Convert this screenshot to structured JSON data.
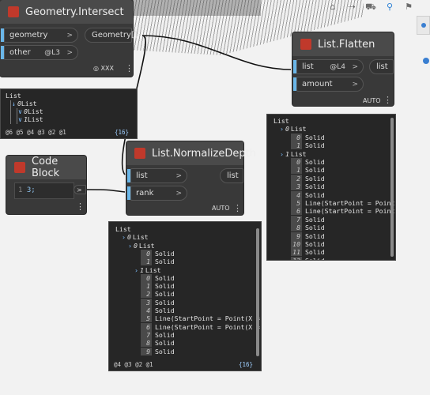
{
  "toolbar": {
    "icons": [
      "home-icon",
      "road-icon",
      "car-icon",
      "bike-icon",
      "walk-icon"
    ]
  },
  "nodes": {
    "intersect": {
      "title": "Geometry.Intersect",
      "inputs": [
        "geometry",
        "other"
      ],
      "other_level": "@L3",
      "output": "Geometry[]",
      "footer": "XXX"
    },
    "flatten": {
      "title": "List.Flatten",
      "inputs": [
        "list",
        "amount"
      ],
      "list_level": "@L4",
      "output": "list",
      "footer": "AUTO"
    },
    "normalize": {
      "title": "List.NormalizeDepth",
      "inputs": [
        "list",
        "rank"
      ],
      "output": "list",
      "footer": "AUTO"
    },
    "codeblock": {
      "title": "Code Block",
      "line_number": "1",
      "code": "3;"
    }
  },
  "watch_intersect": {
    "lines": [
      {
        "text": "List",
        "toggle": "",
        "index": ""
      },
      {
        "text": "List",
        "toggle": "↓",
        "index": "0"
      },
      {
        "text": "List",
        "toggle": "∨",
        "index": "0"
      },
      {
        "text": "List",
        "toggle": "∨",
        "index": "1"
      }
    ],
    "levels": "@6 @5 @4 @3 @2 @1",
    "count": "{16}"
  },
  "watch_flatten": {
    "lines": [
      {
        "text": "List",
        "toggle": "",
        "index": ""
      },
      {
        "text": "List",
        "toggle": "›",
        "index": "0"
      },
      {
        "text": "Solid",
        "toggle": "",
        "index": "0"
      },
      {
        "text": "Solid",
        "toggle": "",
        "index": "1"
      },
      {
        "text": "List",
        "toggle": "›",
        "index": "1"
      },
      {
        "text": "Solid",
        "toggle": "",
        "index": "0"
      },
      {
        "text": "Solid",
        "toggle": "",
        "index": "1"
      },
      {
        "text": "Solid",
        "toggle": "",
        "index": "2"
      },
      {
        "text": "Solid",
        "toggle": "",
        "index": "3"
      },
      {
        "text": "Solid",
        "toggle": "",
        "index": "4"
      },
      {
        "text": "Line(StartPoint = Point(X = –",
        "toggle": "",
        "index": "5"
      },
      {
        "text": "Line(StartPoint = Point(X = –",
        "toggle": "",
        "index": "6"
      },
      {
        "text": "Solid",
        "toggle": "",
        "index": "7"
      },
      {
        "text": "Solid",
        "toggle": "",
        "index": "8"
      },
      {
        "text": "Solid",
        "toggle": "",
        "index": "9"
      },
      {
        "text": "Solid",
        "toggle": "",
        "index": "10"
      },
      {
        "text": "Solid",
        "toggle": "",
        "index": "11"
      },
      {
        "text": "Solid",
        "toggle": "",
        "index": "12"
      }
    ]
  },
  "watch_normalize": {
    "lines": [
      {
        "text": "List",
        "toggle": "",
        "index": ""
      },
      {
        "text": "List",
        "toggle": "›",
        "index": "0"
      },
      {
        "text": "List",
        "toggle": "›",
        "index": "0"
      },
      {
        "text": "Solid",
        "toggle": "",
        "index": "0"
      },
      {
        "text": "Solid",
        "toggle": "",
        "index": "1"
      },
      {
        "text": "List",
        "toggle": "›",
        "index": "1"
      },
      {
        "text": "Solid",
        "toggle": "",
        "index": "0"
      },
      {
        "text": "Solid",
        "toggle": "",
        "index": "1"
      },
      {
        "text": "Solid",
        "toggle": "",
        "index": "2"
      },
      {
        "text": "Solid",
        "toggle": "",
        "index": "3"
      },
      {
        "text": "Solid",
        "toggle": "",
        "index": "4"
      },
      {
        "text": "Line(StartPoint = Point(X =",
        "toggle": "",
        "index": "5"
      },
      {
        "text": "Line(StartPoint = Point(X =",
        "toggle": "",
        "index": "6"
      },
      {
        "text": "Solid",
        "toggle": "",
        "index": "7"
      },
      {
        "text": "Solid",
        "toggle": "",
        "index": "8"
      },
      {
        "text": "Solid",
        "toggle": "",
        "index": "9"
      }
    ],
    "levels": "@4 @3 @2 @1",
    "count": "{16}"
  },
  "colors": {
    "accent": "#6ab6e8",
    "node_bg": "#393939",
    "watch_bg": "#262626",
    "canvas": "#f2f2f2"
  }
}
